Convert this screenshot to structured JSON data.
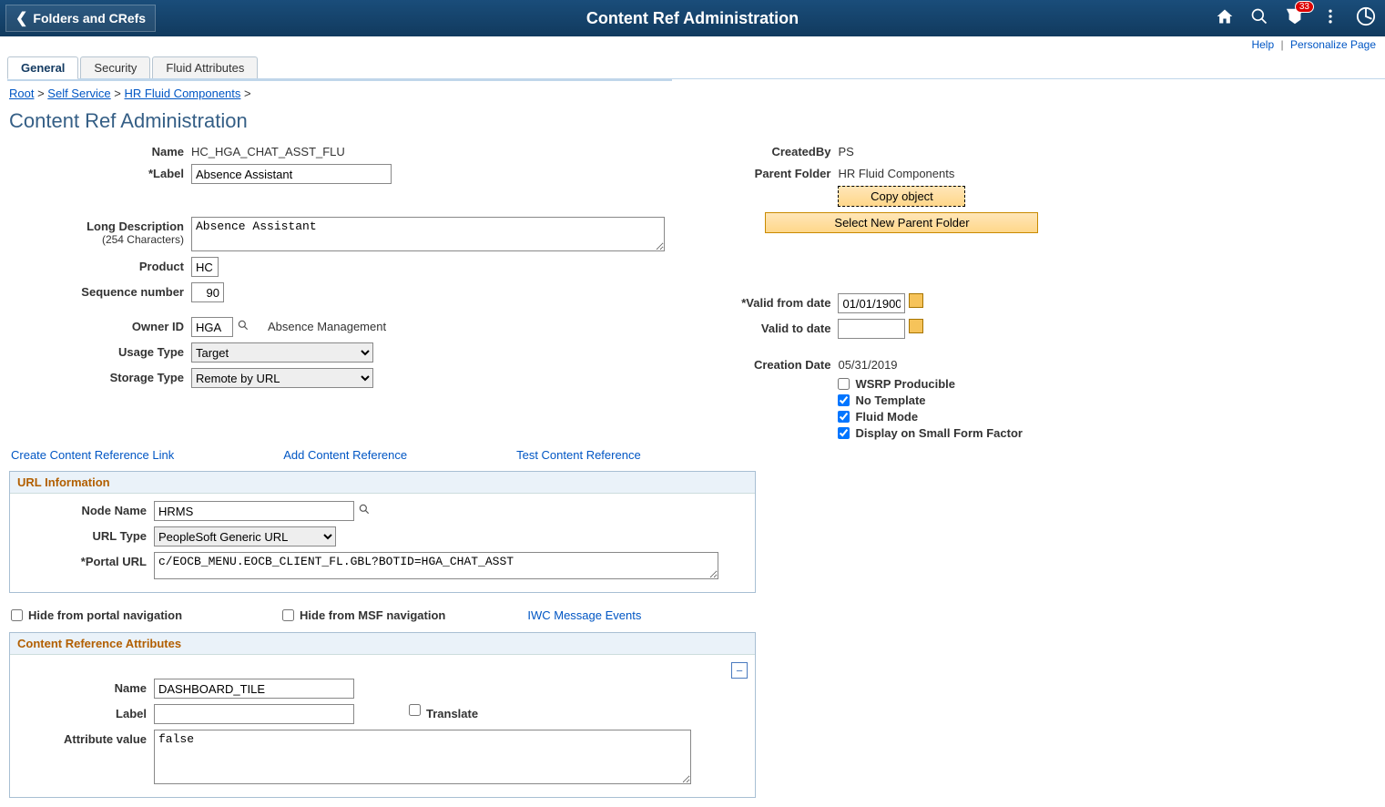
{
  "header": {
    "back_label": "Folders and CRefs",
    "title": "Content Ref Administration",
    "notif_count": "33"
  },
  "toplinks": {
    "help": "Help",
    "personalize": "Personalize Page"
  },
  "tabs": {
    "t1": "General",
    "t2": "Security",
    "t3": "Fluid Attributes"
  },
  "crumbs": {
    "root": "Root",
    "self_service": "Self Service",
    "hr_fluid": "HR Fluid Components"
  },
  "page_title": "Content Ref Administration",
  "labels": {
    "name": "Name",
    "label": "*Label",
    "long_desc": "Long Description",
    "chars": "(254 Characters)",
    "product": "Product",
    "seq": "Sequence number",
    "owner": "Owner ID",
    "usage": "Usage Type",
    "storage": "Storage Type",
    "createdby": "CreatedBy",
    "parent": "Parent Folder",
    "vfrom": "*Valid from date",
    "vto": "Valid to date",
    "cdate": "Creation Date",
    "wsrp": "WSRP Producible",
    "notemplate": "No Template",
    "fluid": "Fluid Mode",
    "small": "Display on Small Form Factor",
    "node": "Node Name",
    "urltype": "URL Type",
    "portalurl": "*Portal URL",
    "hidenav": "Hide from portal navigation",
    "hidemsf": "Hide from MSF navigation",
    "attr_name": "Name",
    "attr_label": "Label",
    "translate": "Translate",
    "attr_val": "Attribute value"
  },
  "values": {
    "name": "HC_HGA_CHAT_ASST_FLU",
    "label": "Absence Assistant",
    "long_desc": "Absence Assistant",
    "product": "HC",
    "seq": "90",
    "owner": "HGA",
    "owner_desc": "Absence Management",
    "usage": "Target",
    "storage": "Remote by URL",
    "createdby": "PS",
    "parent": "HR Fluid Components",
    "vfrom": "01/01/1900",
    "vto": "",
    "cdate": "05/31/2019",
    "wsrp": false,
    "notemplate": true,
    "fluid": true,
    "small": true,
    "node": "HRMS",
    "urltype": "PeopleSoft Generic URL",
    "portalurl": "c/EOCB_MENU.EOCB_CLIENT_FL.GBL?BOTID=HGA_CHAT_ASST",
    "hidenav": false,
    "hidemsf": false,
    "attr_name": "DASHBOARD_TILE",
    "attr_label": "",
    "translate": false,
    "attr_val": "false"
  },
  "buttons": {
    "copy": "Copy object",
    "select_parent": "Select New Parent Folder"
  },
  "links": {
    "create_ref": "Create Content Reference Link",
    "add_ref": "Add Content Reference",
    "test_ref": "Test Content Reference",
    "iwc": "IWC Message Events"
  },
  "sections": {
    "url": "URL Information",
    "attrs": "Content Reference Attributes"
  }
}
